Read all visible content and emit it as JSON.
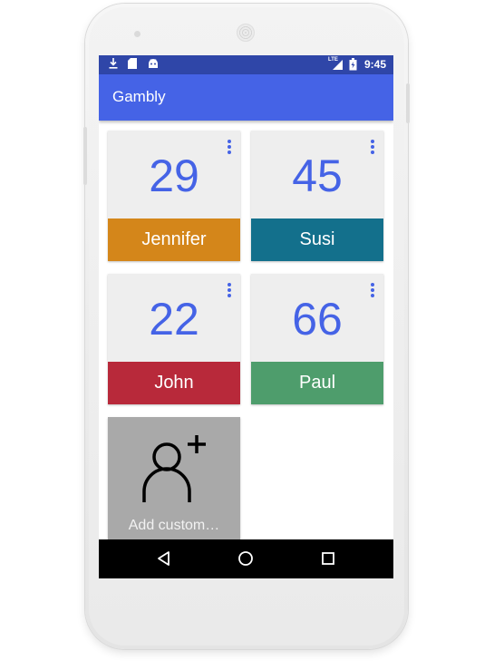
{
  "status_bar": {
    "time": "9:45",
    "network_label": "LTE",
    "icons": [
      "download-icon",
      "sd-card-icon",
      "android-icon",
      "signal-icon",
      "battery-icon"
    ]
  },
  "app": {
    "title": "Gambly"
  },
  "players": [
    {
      "name": "Jennifer",
      "score": "29",
      "color": "#d4861a"
    },
    {
      "name": "Susi",
      "score": "45",
      "color": "#13708c"
    },
    {
      "name": "John",
      "score": "22",
      "color": "#b8293a"
    },
    {
      "name": "Paul",
      "score": "66",
      "color": "#4e9d6c"
    }
  ],
  "add_customer": {
    "label": "Add custom…",
    "icon": "add-person-icon"
  },
  "navigation": {
    "buttons": [
      "back-icon",
      "home-icon",
      "recents-icon"
    ]
  },
  "colors": {
    "status_bar": "#2f46a8",
    "app_bar": "#4563e6",
    "score_text": "#4563e6",
    "card_background": "#eeeeee",
    "add_card_background": "#a9a9a9"
  }
}
